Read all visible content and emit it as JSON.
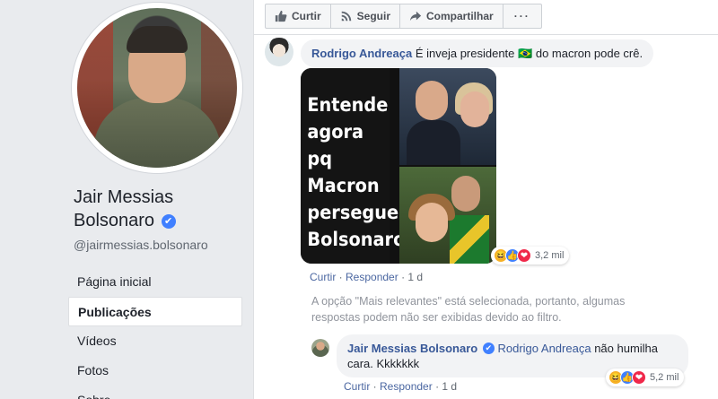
{
  "profile": {
    "name": "Jair Messias Bolsonaro",
    "verified_mark": "✔",
    "handle": "@jairmessias.bolsonaro",
    "nav": [
      {
        "label": "Página inicial",
        "active": false
      },
      {
        "label": "Publicações",
        "active": true
      },
      {
        "label": "Vídeos",
        "active": false
      },
      {
        "label": "Fotos",
        "active": false
      },
      {
        "label": "Sobre",
        "active": false
      }
    ]
  },
  "post_actions": {
    "like": "Curtir",
    "follow": "Seguir",
    "share": "Compartilhar",
    "more": "···"
  },
  "comment1": {
    "author": "Rodrigo Andreaça",
    "text_before": "É inveja presidente",
    "flag_emoji": "🇧🇷",
    "text_after": "do macron pode crê.",
    "image_text": [
      "Entende",
      "agora",
      "pq Macron",
      "persegue",
      "Bolsonaro?"
    ],
    "reaction_count": "3,2 mil",
    "actions": {
      "like": "Curtir",
      "reply": "Responder",
      "age": "1 d"
    }
  },
  "filter_notice": "A opção \"Mais relevantes\" está selecionada, portanto, algumas respostas podem não ser exibidas devido ao filtro.",
  "reply1": {
    "author": "Jair Messias Bolsonaro",
    "mention": "Rodrigo Andreaça",
    "text": "não humilha cara. Kkkkkkk",
    "reaction_count": "5,2 mil",
    "actions": {
      "like": "Curtir",
      "reply": "Responder",
      "age": "1 d"
    }
  },
  "colors": {
    "link_blue": "#385898",
    "verified_blue": "#4080ff",
    "bubble_bg": "#f2f3f5",
    "page_bg": "#e9ebee"
  },
  "icons": [
    "thumbs-up-icon",
    "wifi-follow-icon",
    "share-arrow-icon",
    "more-dots-icon",
    "verified-check-icon",
    "haha-reaction-icon",
    "like-reaction-icon",
    "love-reaction-icon"
  ]
}
